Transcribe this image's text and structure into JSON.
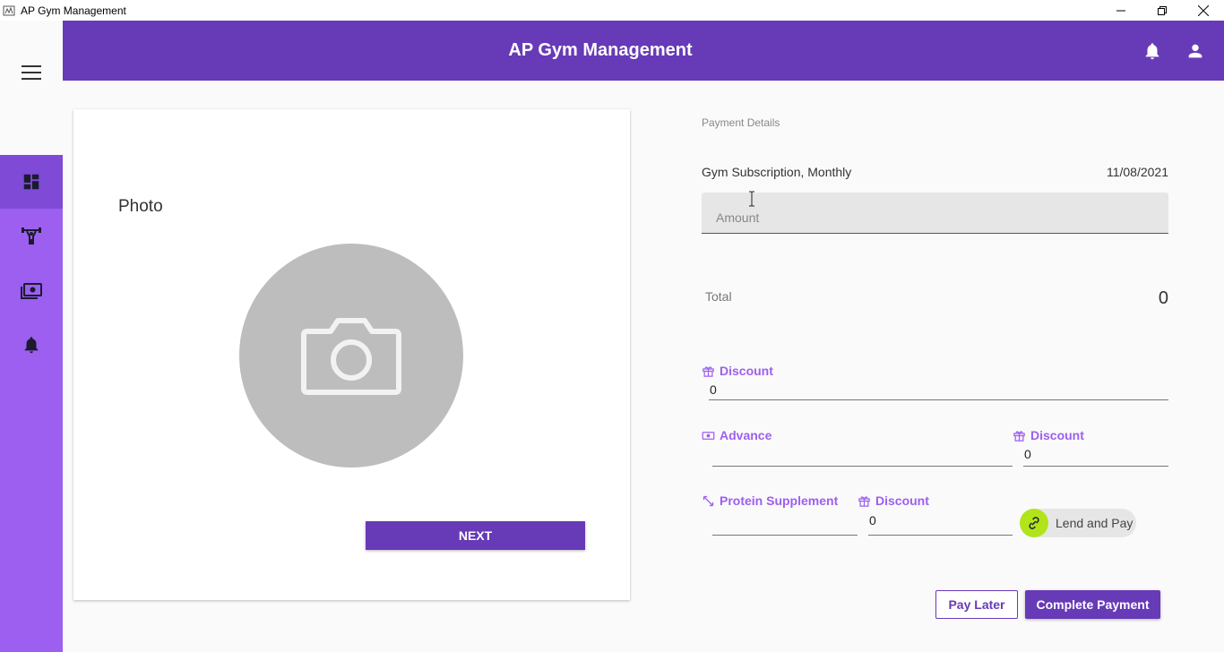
{
  "window": {
    "title": "AP Gym Management"
  },
  "header": {
    "title": "AP Gym Management"
  },
  "colors": {
    "primary": "#673ab7",
    "sidebar": "#9c5ff0",
    "sidebar_active": "#7e4ad6",
    "accent_label": "#9c5ff0",
    "lend_circle": "#b2e41a"
  },
  "sidebar": {
    "items": [
      {
        "icon": "dashboard-icon",
        "active": true
      },
      {
        "icon": "weightlifter-icon",
        "active": false
      },
      {
        "icon": "money-icon",
        "active": false
      },
      {
        "icon": "bell-icon",
        "active": false
      }
    ]
  },
  "photo_card": {
    "label": "Photo",
    "next_label": "NEXT"
  },
  "payment": {
    "title": "Payment Details",
    "subscription": "Gym Subscription, Monthly",
    "date": "11/08/2021",
    "amount_placeholder": "Amount",
    "total_label": "Total",
    "total_value": "0",
    "discount_label": "Discount",
    "discount_value": "0",
    "advance_label": "Advance",
    "advance_value": "",
    "advance_discount_label": "Discount",
    "advance_discount_value": "0",
    "protein_label": "Protein Supplement",
    "protein_value": "",
    "protein_discount_label": "Discount",
    "protein_discount_value": "0",
    "lend_label": "Lend and Pay",
    "pay_later_label": "Pay Later",
    "complete_label": "Complete Payment"
  }
}
